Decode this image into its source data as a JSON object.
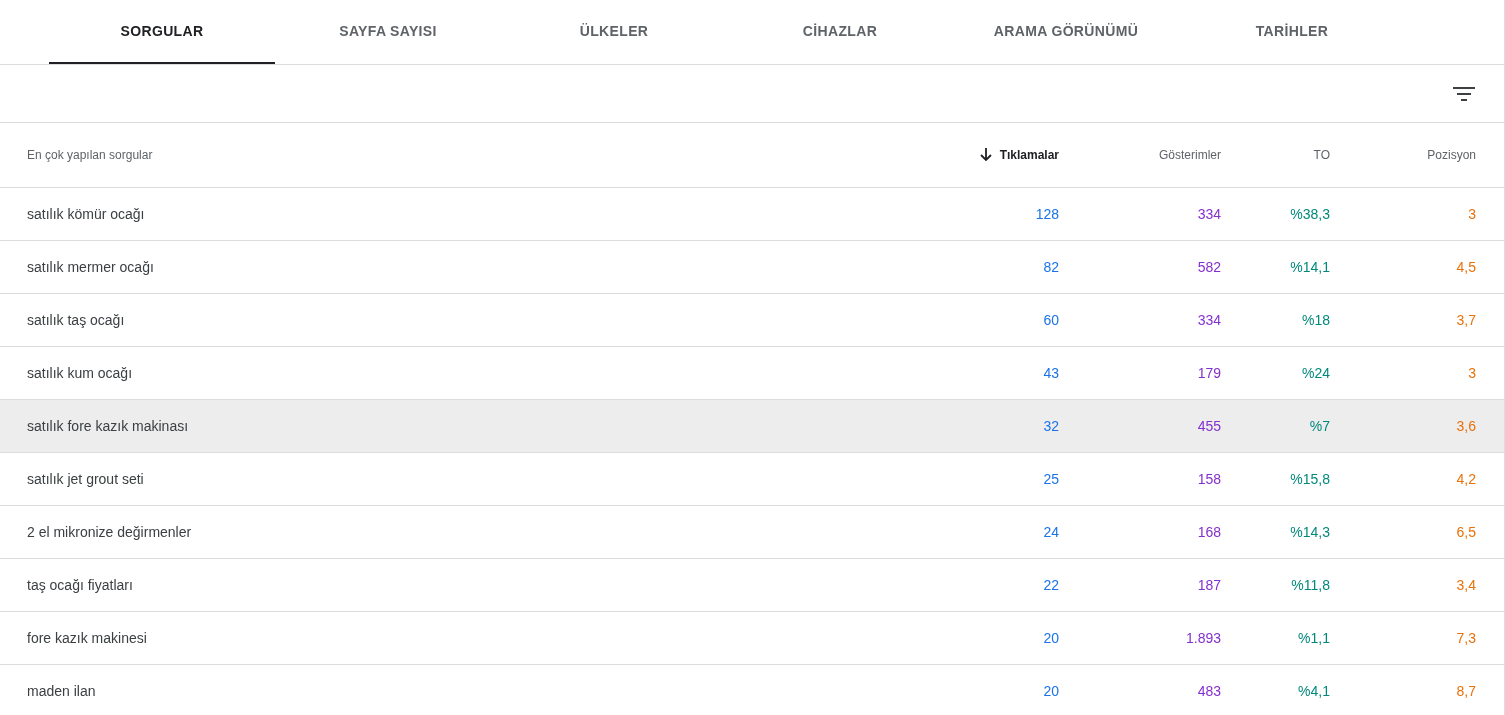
{
  "tabs": [
    {
      "label": "SORGULAR",
      "selected": true
    },
    {
      "label": "SAYFA SAYISI",
      "selected": false
    },
    {
      "label": "ÜLKELER",
      "selected": false
    },
    {
      "label": "CİHAZLAR",
      "selected": false
    },
    {
      "label": "ARAMA GÖRÜNÜMÜ",
      "selected": false
    },
    {
      "label": "TARİHLER",
      "selected": false
    }
  ],
  "table": {
    "columns": [
      {
        "label": "En çok yapılan sorgular",
        "sorted": false
      },
      {
        "label": "Tıklamalar",
        "sorted": true,
        "color": "#1a73e8"
      },
      {
        "label": "Gösterimler",
        "sorted": false,
        "color": "#8430ce"
      },
      {
        "label": "TO",
        "sorted": false,
        "color": "#00897b"
      },
      {
        "label": "Pozisyon",
        "sorted": false,
        "color": "#e8710a"
      }
    ],
    "rows": [
      {
        "cells": [
          "satılık kömür ocağı",
          "128",
          "334",
          "%38,3",
          "3"
        ],
        "highlighted": false
      },
      {
        "cells": [
          "satılık mermer ocağı",
          "82",
          "582",
          "%14,1",
          "4,5"
        ],
        "highlighted": false
      },
      {
        "cells": [
          "satılık taş ocağı",
          "60",
          "334",
          "%18",
          "3,7"
        ],
        "highlighted": false
      },
      {
        "cells": [
          "satılık kum ocağı",
          "43",
          "179",
          "%24",
          "3"
        ],
        "highlighted": false
      },
      {
        "cells": [
          "satılık fore kazık makinası",
          "32",
          "455",
          "%7",
          "3,6"
        ],
        "highlighted": true
      },
      {
        "cells": [
          "satılık jet grout seti",
          "25",
          "158",
          "%15,8",
          "4,2"
        ],
        "highlighted": false
      },
      {
        "cells": [
          "2 el mikronize değirmenler",
          "24",
          "168",
          "%14,3",
          "6,5"
        ],
        "highlighted": false
      },
      {
        "cells": [
          "taş ocağı fiyatları",
          "22",
          "187",
          "%11,8",
          "3,4"
        ],
        "highlighted": false
      },
      {
        "cells": [
          "fore kazık makinesi",
          "20",
          "1.893",
          "%1,1",
          "7,3"
        ],
        "highlighted": false
      },
      {
        "cells": [
          "maden ilan",
          "20",
          "483",
          "%4,1",
          "8,7"
        ],
        "highlighted": false
      }
    ]
  }
}
